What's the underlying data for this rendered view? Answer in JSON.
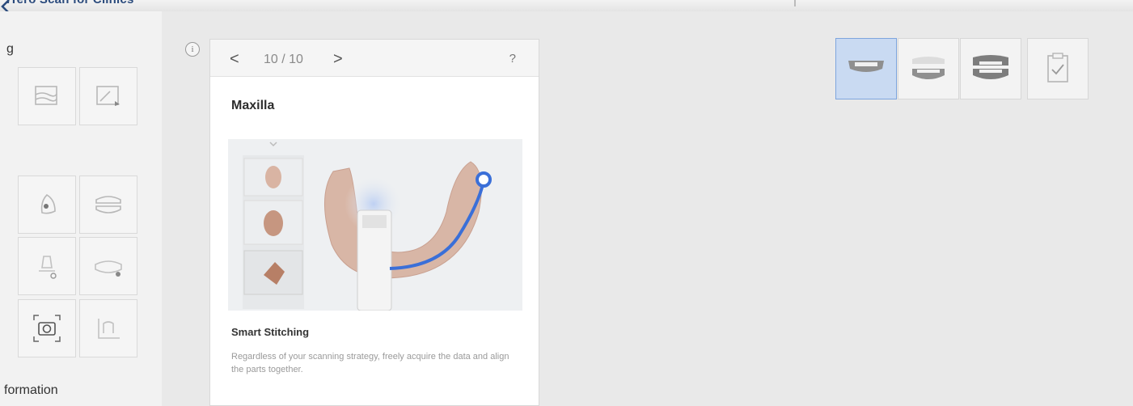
{
  "app": {
    "title": "iTero Scan for Clinics"
  },
  "sidebar": {
    "section_top": "g",
    "section_bottom": "formation",
    "tools": [
      {
        "icon": "scan-layers-icon"
      },
      {
        "icon": "edit-region-icon"
      },
      {
        "icon": "brush-tooth-icon"
      },
      {
        "icon": "jaw-occlusion-icon"
      },
      {
        "icon": "implant-icon"
      },
      {
        "icon": "jaw-settings-icon"
      },
      {
        "icon": "camera-capture-icon"
      },
      {
        "icon": "margin-line-icon"
      }
    ]
  },
  "tutorial": {
    "info_glyph": "i",
    "prev": "<",
    "pager": "10 / 10",
    "next": ">",
    "help": "?",
    "title": "Maxilla",
    "feature_title": "Smart Stitching",
    "feature_desc": "Regardless of your scanning strategy, freely acquire the data and align the parts together."
  },
  "steps": [
    {
      "icon": "maxilla-icon",
      "active": true
    },
    {
      "icon": "mandible-icon",
      "active": false
    },
    {
      "icon": "occlusion-icon",
      "active": false
    },
    {
      "icon": "review-check-icon",
      "active": false
    }
  ],
  "colors": {
    "accent": "#7ea5dd",
    "active_bg": "#c9daf2",
    "stitch_line": "#3a6fd8"
  }
}
